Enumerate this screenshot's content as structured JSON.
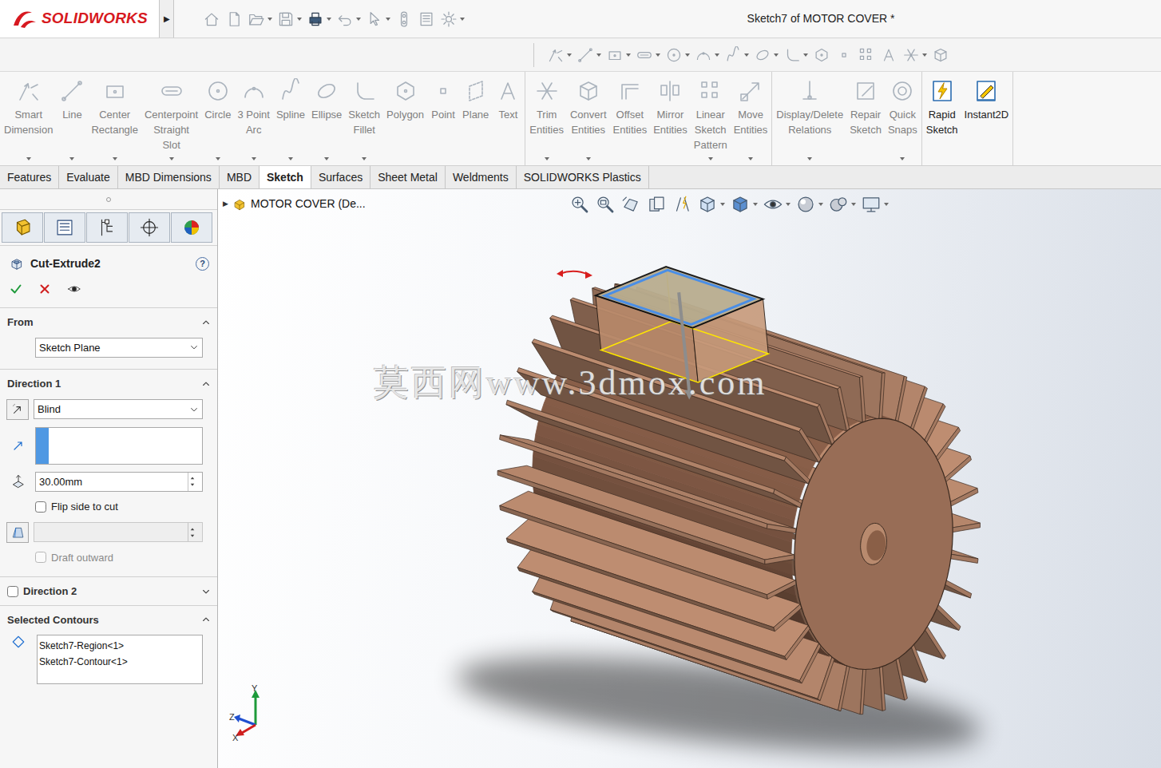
{
  "app": {
    "logo": "SOLIDWORKS",
    "menu_toggle": "▶"
  },
  "window": {
    "title": "Sketch7 of MOTOR COVER *"
  },
  "command_groups": [
    {
      "items": [
        {
          "label": "Smart\nDimension",
          "disabled": true,
          "menu": true
        },
        {
          "label": "Line",
          "disabled": true,
          "menu": true
        },
        {
          "label": "Center\nRectangle",
          "disabled": true,
          "menu": true
        },
        {
          "label": "Centerpoint\nStraight\nSlot",
          "disabled": true,
          "menu": true
        },
        {
          "label": "Circle",
          "disabled": true,
          "menu": true
        },
        {
          "label": "3 Point\nArc",
          "disabled": true,
          "menu": true
        },
        {
          "label": "Spline",
          "disabled": true,
          "menu": true
        },
        {
          "label": "Ellipse",
          "disabled": true,
          "menu": true
        },
        {
          "label": "Sketch\nFillet",
          "disabled": true,
          "menu": true
        },
        {
          "label": "Polygon",
          "disabled": true,
          "menu": false
        },
        {
          "label": "Point",
          "disabled": true,
          "menu": false
        },
        {
          "label": "Plane",
          "disabled": true,
          "menu": false
        },
        {
          "label": "Text",
          "disabled": true,
          "menu": false
        }
      ]
    },
    {
      "items": [
        {
          "label": "Trim\nEntities",
          "disabled": true,
          "menu": true
        },
        {
          "label": "Convert\nEntities",
          "disabled": true,
          "menu": true
        },
        {
          "label": "Offset\nEntities",
          "disabled": true,
          "menu": false
        },
        {
          "label": "Mirror\nEntities",
          "disabled": true,
          "menu": false
        },
        {
          "label": "Linear\nSketch\nPattern",
          "disabled": true,
          "menu": true
        },
        {
          "label": "Move\nEntities",
          "disabled": true,
          "menu": true
        }
      ]
    },
    {
      "items": [
        {
          "label": "Display/Delete\nRelations",
          "disabled": true,
          "menu": true
        },
        {
          "label": "Repair\nSketch",
          "disabled": true,
          "menu": false
        },
        {
          "label": "Quick\nSnaps",
          "disabled": true,
          "menu": true
        }
      ]
    },
    {
      "items": [
        {
          "label": "Rapid\nSketch",
          "disabled": false,
          "menu": false
        },
        {
          "label": "Instant2D",
          "disabled": false,
          "menu": false
        }
      ]
    }
  ],
  "tabs": [
    {
      "label": "Features",
      "selected": false
    },
    {
      "label": "Evaluate",
      "selected": false
    },
    {
      "label": "MBD Dimensions",
      "selected": false
    },
    {
      "label": "MBD",
      "selected": false
    },
    {
      "label": "Sketch",
      "selected": true
    },
    {
      "label": "Surfaces",
      "selected": false
    },
    {
      "label": "Sheet Metal",
      "selected": false
    },
    {
      "label": "Weldments",
      "selected": false
    },
    {
      "label": "SOLIDWORKS Plastics",
      "selected": false
    }
  ],
  "tree": {
    "toggle": "▶",
    "label": "MOTOR COVER (De..."
  },
  "property_manager": {
    "title": "Cut-Extrude2",
    "help": "?",
    "from": {
      "title": "From",
      "expanded": true,
      "value": "Sketch Plane"
    },
    "direction1": {
      "title": "Direction 1",
      "expanded": true,
      "end_condition": "Blind",
      "selection_active": true,
      "depth": "30.00mm",
      "flip": {
        "label": "Flip side to cut",
        "checked": false
      },
      "draft_angle": {
        "value": "",
        "disabled": true
      },
      "draft_outward": {
        "label": "Draft outward",
        "checked": false,
        "disabled": true
      }
    },
    "direction2": {
      "title": "Direction 2",
      "enabled": false,
      "expanded": false
    },
    "selected_contours": {
      "title": "Selected Contours",
      "expanded": true,
      "items": [
        "Sketch7-Region<1>",
        "Sketch7-Contour<1>"
      ]
    }
  },
  "viewport": {
    "watermark": "莫西网www.3dmox.com",
    "triad": {
      "y": "Y",
      "z": "Z",
      "x": "X"
    }
  }
}
